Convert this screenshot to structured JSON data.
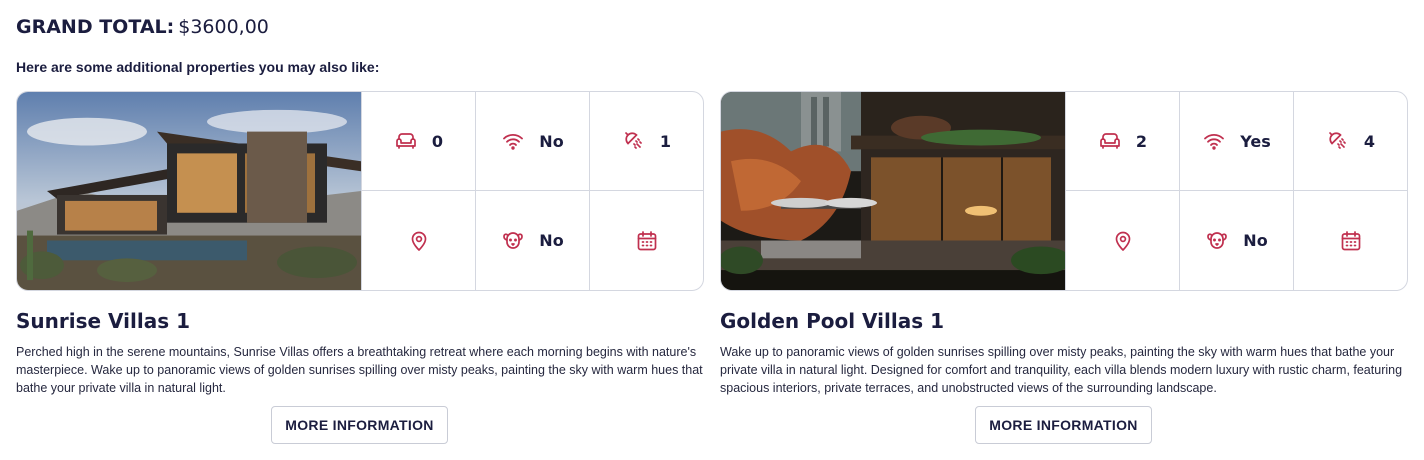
{
  "grand_total": {
    "label": "GRAND TOTAL:",
    "value": "$3600,00"
  },
  "subtitle": "Here are some additional properties you may also like:",
  "colors": {
    "accent": "#c0304f",
    "text": "#1b1d3f",
    "border": "#d4d7e0"
  },
  "properties": [
    {
      "title": "Sunrise Villas 1",
      "description": "Perched high in the serene mountains, Sunrise Villas offers a breathtaking retreat where each morning begins with nature's masterpiece. Wake up to panoramic views of golden sunrises spilling over misty peaks, painting the sky with warm hues that bathe your private villa in natural light.",
      "amenities": {
        "sofa": "0",
        "wifi": "No",
        "shower": "1",
        "pets": "No"
      },
      "button": "MORE INFORMATION"
    },
    {
      "title": "Golden Pool Villas 1",
      "description": " Wake up to panoramic views of golden sunrises spilling over misty peaks, painting the sky with warm hues that bathe your private villa in natural light. Designed for comfort and tranquility, each villa blends modern luxury with rustic charm, featuring spacious interiors, private terraces, and unobstructed views of the surrounding landscape.",
      "amenities": {
        "sofa": "2",
        "wifi": "Yes",
        "shower": "4",
        "pets": "No"
      },
      "button": "MORE INFORMATION"
    }
  ]
}
